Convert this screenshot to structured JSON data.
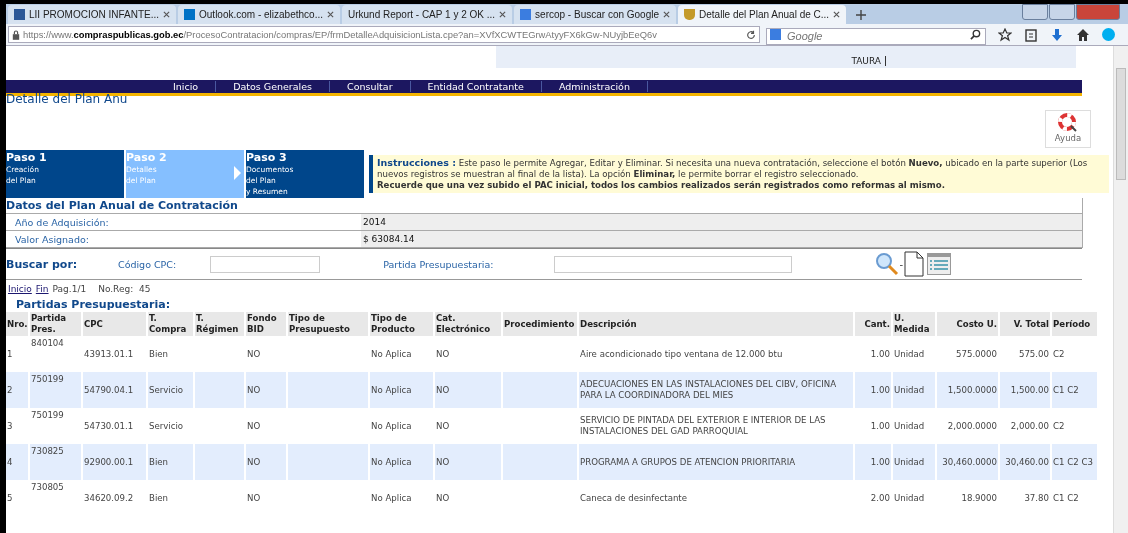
{
  "browser": {
    "tabs": [
      {
        "title": "LII PROMOCION INFANTE...",
        "selected": false
      },
      {
        "title": "Outlook.com - elizabethco...",
        "selected": false
      },
      {
        "title": "Urkund Report - CAP 1 y 2 OK ...",
        "selected": false
      },
      {
        "title": "sercop - Buscar con Google",
        "selected": false
      },
      {
        "title": "Detalle del Plan Anual de C...",
        "selected": true
      }
    ],
    "url": "https://www.**compraspublicas.gob.ec**/ProcesoContratacion/compras/EP/frmDetalleAdquisicionLista.cpe?an=XVfXCWTEGrwAtyyFX6kGw-NUyjbEeQ6v",
    "search_placeholder": "Google"
  },
  "header_user": "TAURA",
  "nav": [
    "Inicio",
    "Datos Generales",
    "Consultar",
    "Entidad Contratante",
    "Administración"
  ],
  "page_title": "Detalle del Plan Anu",
  "help_label": "Ayuda",
  "steps": [
    {
      "title": "Paso 1",
      "lines": [
        "Creación",
        "del Plan"
      ],
      "selected": false
    },
    {
      "title": "Paso 2",
      "lines": [
        "Detalles",
        "del Plan"
      ],
      "selected": true
    },
    {
      "title": "Paso 3",
      "lines": [
        "Documentos",
        "del Plan",
        "y Resumen"
      ],
      "selected": false
    }
  ],
  "instructions": {
    "label": "Instrucciones :",
    "text": "Este paso le permite Agregar, Editar y Eliminar. Si necesita una nueva contratación, seleccione el botón **Nuevo,** ubicado en la parte superior (Los nuevos registros se muestran al final de la lista). La opción **Eliminar,** le permite borrar el registro seleccionado.",
    "note": "Recuerde que una vez subido el PAC inicial, todos los cambios realizados serán registrados como reformas al mismo."
  },
  "plan": {
    "title": "Datos del Plan Anual de Contratación",
    "fields": [
      {
        "label": "Año de Adquisición:",
        "value": "2014"
      },
      {
        "label": "Valor Asignado:",
        "value": "$ 63084.14"
      }
    ]
  },
  "search": {
    "label": "Buscar por:",
    "fields": [
      {
        "label": "Código CPC:"
      },
      {
        "label": "Partida Presupuestaria:"
      }
    ],
    "separator": "-"
  },
  "pager": {
    "links": [
      "Inicio",
      "Fin"
    ],
    "page": "Pag.1/1",
    "count": "No.Reg:  45"
  },
  "table": {
    "title": "Partidas Presupuestaria:",
    "columns": [
      "Nro.",
      "Partida Pres.",
      "CPC",
      "T. Compra",
      "T. Régimen",
      "Fondo BID",
      "Tipo de Presupuesto",
      "Tipo de Producto",
      "Cat. Electrónico",
      "Procedimiento",
      "Descripción",
      "Cant.",
      "U. Medida",
      "Costo U.",
      "V. Total",
      "Período"
    ],
    "rows": [
      [
        "1",
        "840104",
        "43913.01.1",
        "Bien",
        "",
        "NO",
        "",
        "No Aplica",
        "NO",
        "",
        "Aire acondicionado tipo ventana de 12.000 btu",
        "1.00",
        "Unidad",
        "575.0000",
        "575.00",
        "C2"
      ],
      [
        "2",
        "750199",
        "54790.04.1",
        "Servicio",
        "",
        "NO",
        "",
        "No Aplica",
        "NO",
        "",
        "ADECUACIONES EN LAS INSTALACIONES DEL CIBV, OFICINA PARA LA COORDINADORA DEL MIES",
        "1.00",
        "Unidad",
        "1,500.0000",
        "1,500.00",
        "C1 C2"
      ],
      [
        "3",
        "750199",
        "54730.01.1",
        "Servicio",
        "",
        "NO",
        "",
        "No Aplica",
        "NO",
        "",
        "SERVICIO DE PINTADA DEL EXTERIOR E INTERIOR DE LAS INSTALACIONES DEL GAD PARROQUIAL",
        "1.00",
        "Unidad",
        "2,000.0000",
        "2,000.00",
        "C2"
      ],
      [
        "4",
        "730825",
        "92900.00.1",
        "Bien",
        "",
        "NO",
        "",
        "No Aplica",
        "NO",
        "",
        "PROGRAMA A GRUPOS DE ATENCION PRIORITARIA",
        "1.00",
        "Unidad",
        "30,460.0000",
        "30,460.00",
        "C1 C2 C3"
      ],
      [
        "5",
        "730805",
        "34620.09.2",
        "Bien",
        "",
        "NO",
        "",
        "No Aplica",
        "NO",
        "",
        "Caneca de desinfectante",
        "2.00",
        "Unidad",
        "18.9000",
        "37.80",
        "C1 C2"
      ]
    ]
  }
}
